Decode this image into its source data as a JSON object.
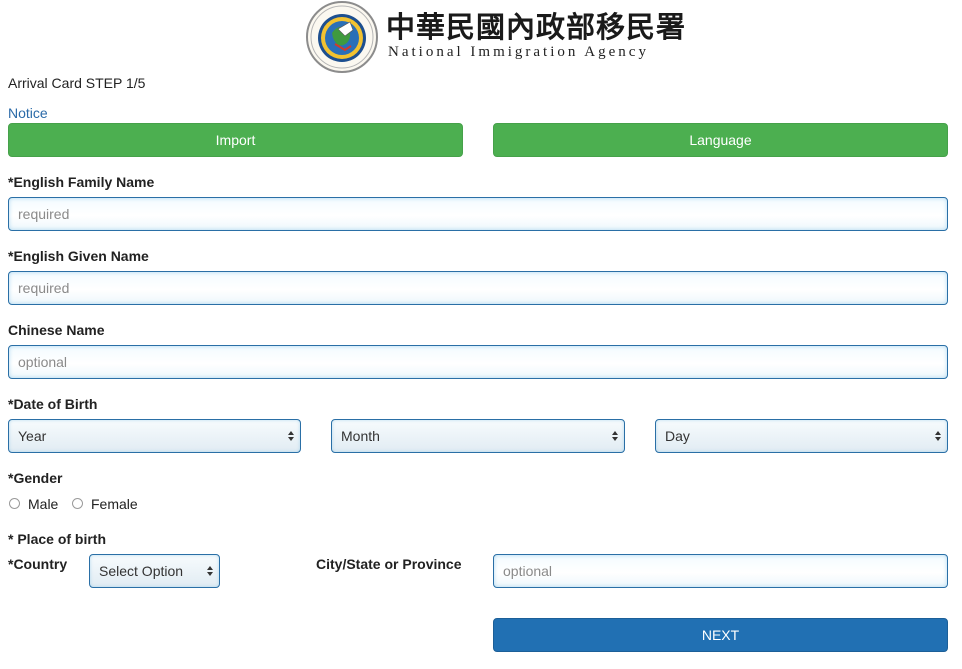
{
  "header": {
    "agency_name_zh": "中華民國內政部移民署",
    "agency_name_en": "National Immigration Agency"
  },
  "page": {
    "step_label": "Arrival Card STEP 1/5",
    "notice_link": "Notice"
  },
  "buttons": {
    "import": "Import",
    "language": "Language",
    "next": "NEXT"
  },
  "fields": {
    "family_name": {
      "label": "*English Family Name",
      "placeholder": "required",
      "value": ""
    },
    "given_name": {
      "label": "*English Given Name",
      "placeholder": "required",
      "value": ""
    },
    "chinese_name": {
      "label": "Chinese Name",
      "placeholder": "optional",
      "value": ""
    },
    "dob": {
      "label": "*Date of Birth",
      "year": "Year",
      "month": "Month",
      "day": "Day"
    },
    "gender": {
      "label": "*Gender",
      "options": [
        "Male",
        "Female"
      ]
    },
    "place_of_birth": {
      "label": "* Place of birth",
      "country_label": "*Country",
      "country_value": "Select Option",
      "city_label": "City/State or Province",
      "city_placeholder": "optional"
    }
  },
  "colors": {
    "green_button": "#4caf50",
    "blue_button": "#2170b3",
    "link": "#2a6aa8",
    "field_border": "#2a6fa6"
  },
  "icons": {
    "seal": "national-immigration-agency-seal",
    "select_arrows": "select-updown-arrows"
  }
}
